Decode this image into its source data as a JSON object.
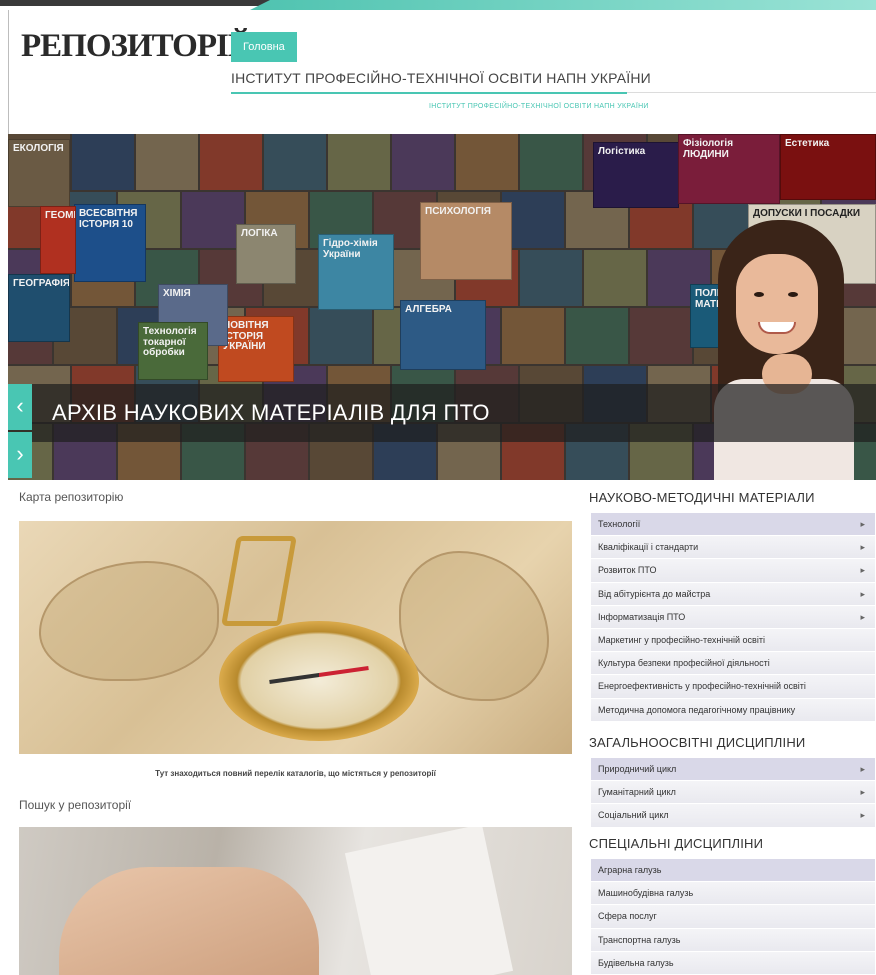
{
  "header": {
    "logo_text": "РЕПОЗИТОРІЙ",
    "nav_home": "Головна",
    "institute_title": "ІНСТИТУТ ПРОФЕСІЙНО-ТЕХНІЧНОЇ ОСВІТИ НАПН УКРАЇНИ",
    "institute_small": "ІНСТИТУТ ПРОФЕСІЙНО-ТЕХНІЧНОЇ ОСВІТИ НАПН УКРАЇНИ"
  },
  "hero": {
    "caption": "АРХІВ НАУКОВИХ МАТЕРІАЛІВ ДЛЯ ПТО",
    "prev_icon": "chevron-left-icon",
    "next_icon": "chevron-right-icon",
    "prev_glyph": "‹",
    "next_glyph": "›",
    "books": [
      {
        "title": "ЕКОЛОГІЯ",
        "color": "#6a5a44"
      },
      {
        "title": "ВСЕСВІТНЯ ІСТОРІЯ 10",
        "color": "#1d4f8a"
      },
      {
        "title": "ЛОГІКА",
        "color": "#8c8670"
      },
      {
        "title": "ПСИХОЛОГІЯ",
        "color": "#b58a66"
      },
      {
        "title": "Логістика",
        "color": "#2a1c4a"
      },
      {
        "title": "Фізіологія ЛЮДИНИ",
        "color": "#7a1d3a"
      },
      {
        "title": "ГЕОГРАФІЯ",
        "color": "#1f4e6e"
      },
      {
        "title": "Гідро-хімія України",
        "color": "#3d86a3"
      },
      {
        "title": "АЛГЕБРА",
        "color": "#2d5a85"
      },
      {
        "title": "ПОЛІГРА МАТЕРІА",
        "color": "#1a5a78"
      },
      {
        "title": "НОВІТНЯ ІСТОРІЯ УКРАЇНИ",
        "color": "#c04a20"
      },
      {
        "title": "ДОПУСКИ І ПОСАДКИ",
        "color": "#d8d2c2"
      },
      {
        "title": "Естетика",
        "color": "#7a1010"
      },
      {
        "title": "ГЕОМЕТРІЯ",
        "color": "#b03020"
      },
      {
        "title": "ХІМІЯ",
        "color": "#5a6a8a"
      },
      {
        "title": "Технологія токарної обробки",
        "color": "#4a6a3a"
      }
    ]
  },
  "main": {
    "map_heading": "Карта репозиторію",
    "map_caption": "Тут знаходиться повний перелік каталогів, що містяться у репозиторії",
    "search_heading": "Пошук у репозиторії"
  },
  "sidebar": {
    "section1": {
      "title": "НАУКОВО-МЕТОДИЧНІ МАТЕРІАЛИ",
      "items": [
        {
          "label": "Технології",
          "arrow": "▸"
        },
        {
          "label": "Кваліфікації і стандарти",
          "arrow": "▸"
        },
        {
          "label": "Розвиток ПТО",
          "arrow": "▸"
        },
        {
          "label": "Від абітурієнта до майстра",
          "arrow": "▸"
        },
        {
          "label": "Інформатизація ПТО",
          "arrow": "▸"
        },
        {
          "label": "Маркетинг у професійно-технічній освіті"
        },
        {
          "label": "Культура безпеки професійної діяльності"
        },
        {
          "label": "Енергоефективність у професійно-технічній освіті"
        },
        {
          "label": "Методична допомога педагогічному працівнику"
        }
      ]
    },
    "section2": {
      "title": "ЗАГАЛЬНООСВІТНІ ДИСЦИПЛІНИ",
      "items": [
        {
          "label": "Природничий цикл",
          "arrow": "▸"
        },
        {
          "label": "Гуманітарний цикл",
          "arrow": "▸"
        },
        {
          "label": "Соціальний цикл",
          "arrow": "▸"
        }
      ]
    },
    "section3": {
      "title": "СПЕЦІАЛЬНІ ДИСЦИПЛІНИ",
      "items": [
        {
          "label": "Аграрна галузь"
        },
        {
          "label": "Машинобудівна галузь"
        },
        {
          "label": "Сфера послуг"
        },
        {
          "label": "Транспортна галузь"
        },
        {
          "label": "Будівельна галузь"
        }
      ]
    }
  }
}
